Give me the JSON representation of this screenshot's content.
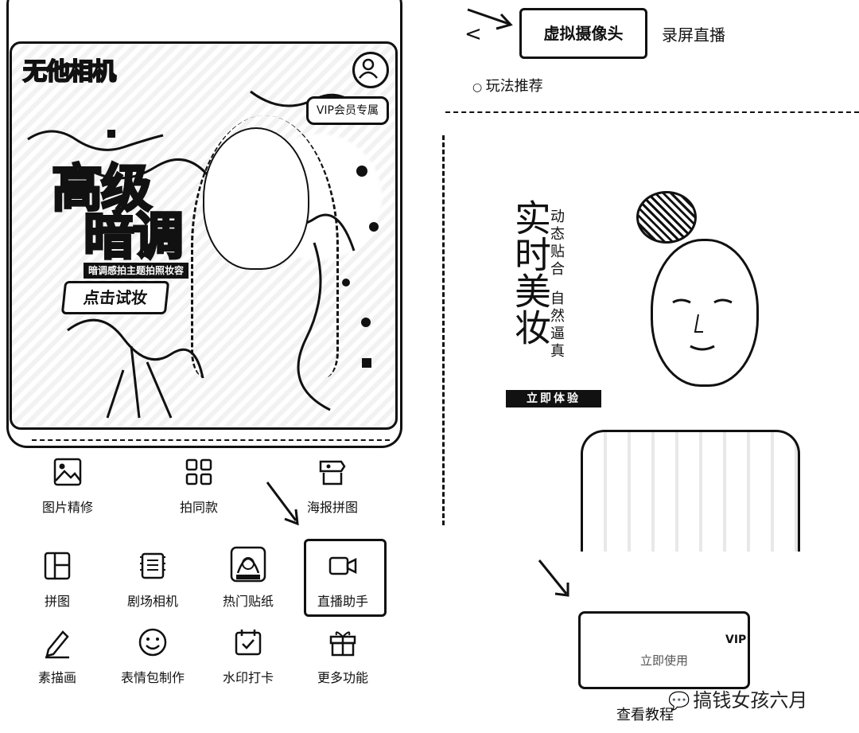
{
  "left_app": {
    "brand": "无他相机",
    "vip_tag": "VIP会员专属",
    "banner_title_1": "高级",
    "banner_title_2": "暗调",
    "banner_subline": "暗调感拍主题拍照妆容",
    "banner_button": "点击试妆",
    "row1": [
      {
        "label": "图片精修",
        "icon": "image-icon"
      },
      {
        "label": "拍同款",
        "icon": "grid-icon"
      },
      {
        "label": "海报拼图",
        "icon": "poster-icon"
      }
    ],
    "row2": [
      {
        "label": "拼图",
        "icon": "collage-icon"
      },
      {
        "label": "剧场相机",
        "icon": "film-icon"
      },
      {
        "label": "热门贴纸",
        "icon": "sticker-icon"
      },
      {
        "label": "直播助手",
        "icon": "video-camera-icon"
      }
    ],
    "row3": [
      {
        "label": "素描画",
        "icon": "pencil-icon"
      },
      {
        "label": "表情包制作",
        "icon": "smiley-icon"
      },
      {
        "label": "水印打卡",
        "icon": "calendar-check-icon"
      },
      {
        "label": "更多功能",
        "icon": "gift-box-icon"
      }
    ]
  },
  "right_app": {
    "back": "<",
    "tab_active": "虚拟摄像头",
    "tab_other": "录屏直播",
    "section_title": "玩法推荐",
    "promo_title": "实时美妆",
    "promo_sub_1": "动态贴合",
    "promo_sub_2": "自然逼真",
    "promo_button": "立即体验",
    "vip_mini": "VIP",
    "use_button": "立即使用",
    "tutorial": "查看教程"
  },
  "watermark": "搞钱女孩六月",
  "colors": {
    "ink": "#111111",
    "paper": "#ffffff"
  }
}
